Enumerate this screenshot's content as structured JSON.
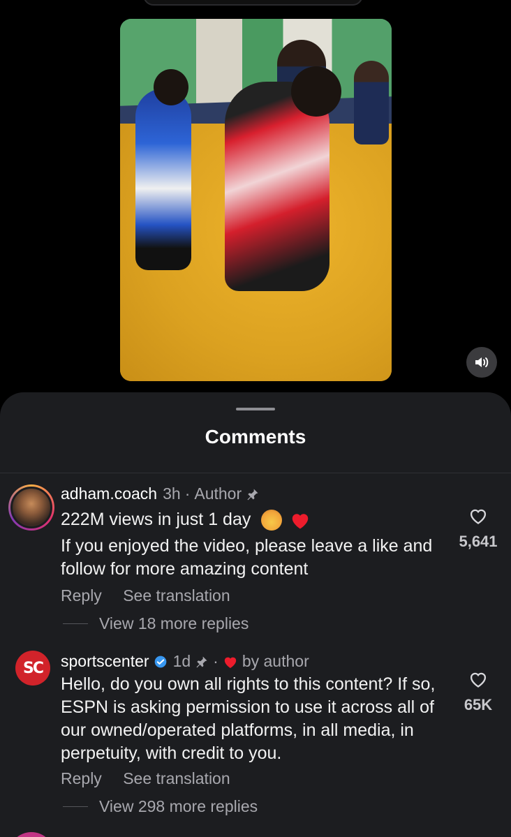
{
  "video": {
    "sound_icon": "speaker-icon"
  },
  "sheet": {
    "title": "Comments"
  },
  "comments": [
    {
      "username": "adham.coach",
      "time": "3h",
      "separator": "·",
      "badge": "Author",
      "pinned_icon": "pin-icon",
      "line1": "222M views in just 1 day",
      "body": "If you enjoyed the video, please leave a like and follow for more amazing content",
      "reply": "Reply",
      "translate": "See translation",
      "view_replies": "View 18 more replies",
      "likes": "5,641"
    },
    {
      "username": "sportscenter",
      "avatar_text": "SC",
      "verified_icon": "verified-icon",
      "time": "1d",
      "separator": "·",
      "liked_by": "by author",
      "body": "Hello, do you own all rights to this content? If so, ESPN is asking permission to use it across all of our owned/operated platforms, in all media, in perpetuity, with credit to you.",
      "reply": "Reply",
      "translate": "See translation",
      "view_replies": "View 298 more replies",
      "likes": "65K"
    }
  ],
  "colors": {
    "sheet_bg": "#1c1d20",
    "verified": "#3897f0",
    "heart": "#ed1c2c",
    "sc_red": "#d1232a"
  }
}
